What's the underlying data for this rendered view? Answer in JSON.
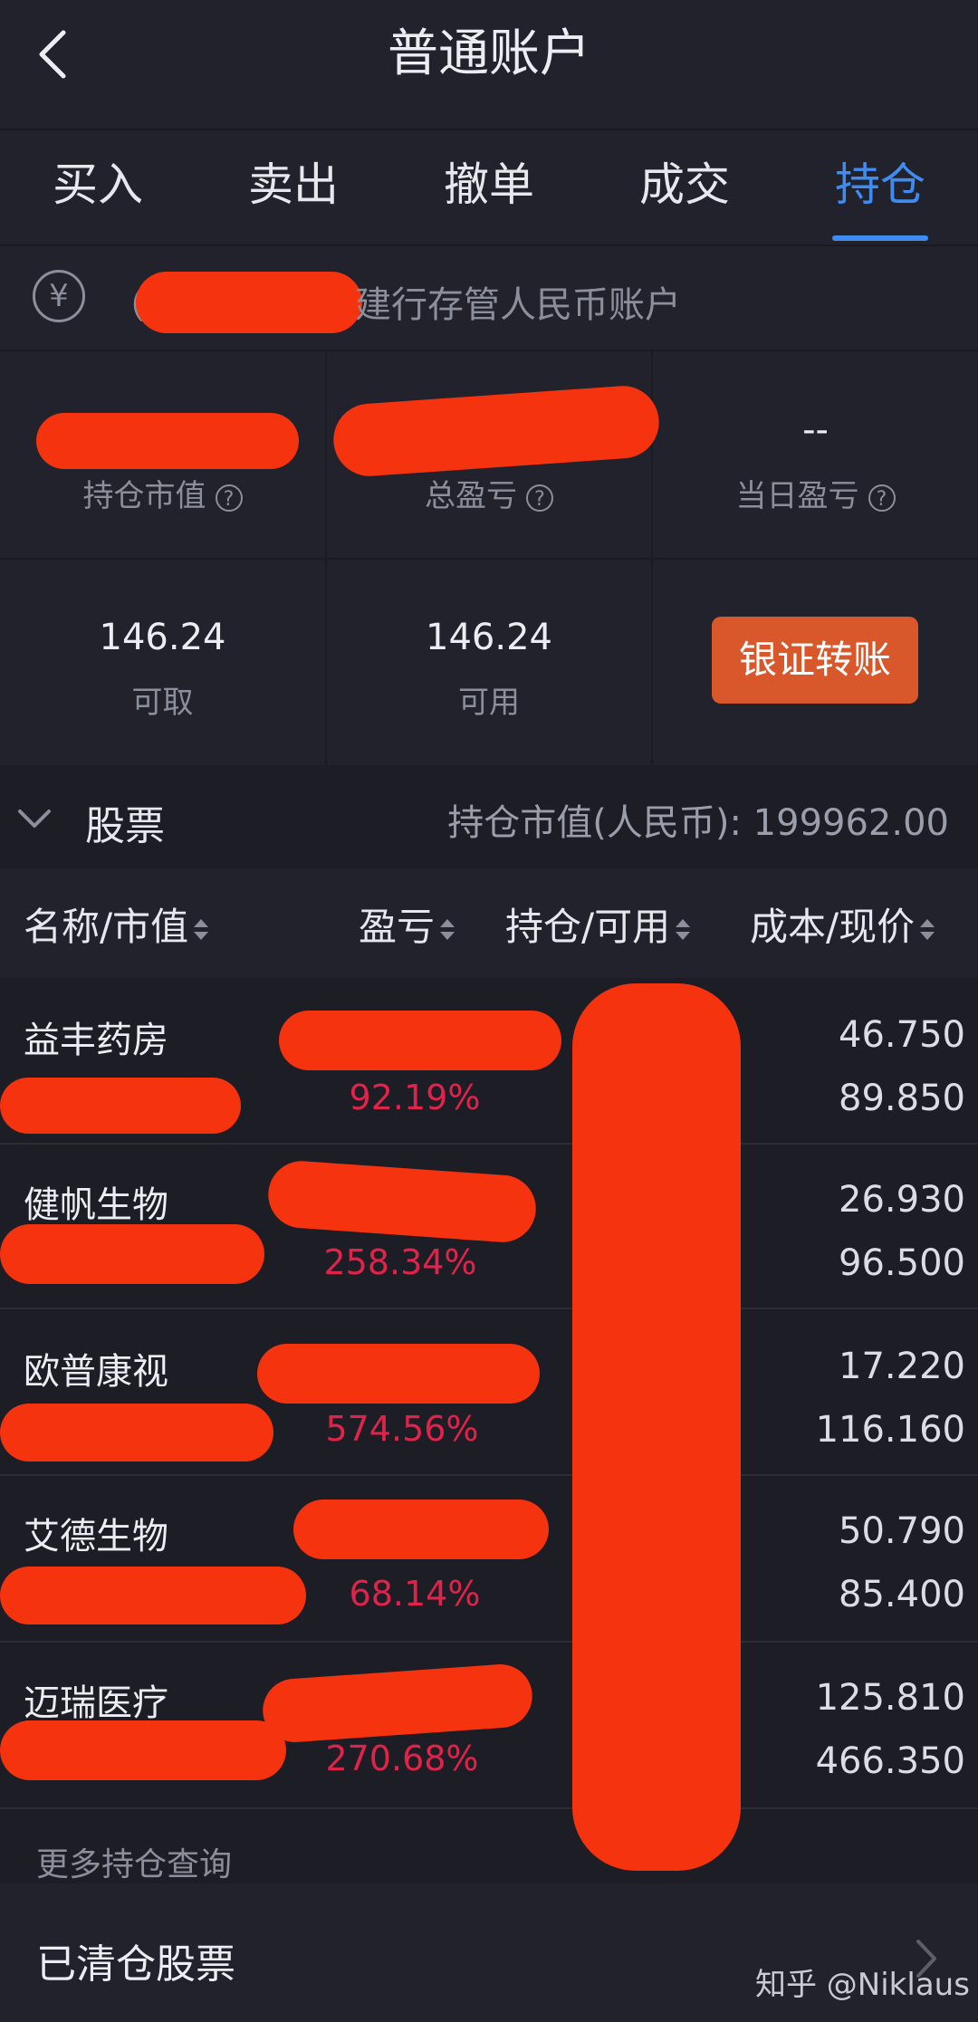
{
  "header": {
    "title": "普通账户",
    "back_icon": "chevron-left-icon"
  },
  "tabs": [
    {
      "label": "买入",
      "active": false
    },
    {
      "label": "卖出",
      "active": false
    },
    {
      "label": "撤单",
      "active": false
    },
    {
      "label": "成交",
      "active": false
    },
    {
      "label": "持仓",
      "active": true
    }
  ],
  "account": {
    "currency_icon": "¥",
    "open_paren": "（",
    "text": "建行存管人民币账户"
  },
  "summary": {
    "market_value_label": "持仓市值",
    "total_pnl_label": "总盈亏",
    "daily_pnl_value": "--",
    "daily_pnl_label": "当日盈亏",
    "help_icon": "?",
    "withdrawable_value": "146.24",
    "withdrawable_label": "可取",
    "available_value": "146.24",
    "available_label": "可用",
    "transfer_button": "银证转账"
  },
  "stocks": {
    "section_label": "股票",
    "market_value_summary": "持仓市值(人民币): 199962.00",
    "columns": [
      "名称/市值",
      "盈亏",
      "持仓/可用",
      "成本/现价"
    ],
    "rows": [
      {
        "name": "益丰药房",
        "pct": "92.19%",
        "cost": "46.750",
        "price": "89.850"
      },
      {
        "name": "健帆生物",
        "pct": "258.34%",
        "cost": "26.930",
        "price": "96.500"
      },
      {
        "name": "欧普康视",
        "pct": "574.56%",
        "cost": "17.220",
        "price": "116.160"
      },
      {
        "name": "艾德生物",
        "pct": "68.14%",
        "cost": "50.790",
        "price": "85.400"
      },
      {
        "name": "迈瑞医疗",
        "pct": "270.68%",
        "cost": "125.810",
        "price": "466.350"
      }
    ],
    "more_link": "更多持仓查询",
    "cleared_label": "已清仓股票"
  },
  "watermark": "知乎 @Niklaus",
  "colors": {
    "accent": "#3f8cf1",
    "loss_gain_red": "#e0234a",
    "transfer_button": "#d8582c",
    "redaction": "#f5330f"
  }
}
